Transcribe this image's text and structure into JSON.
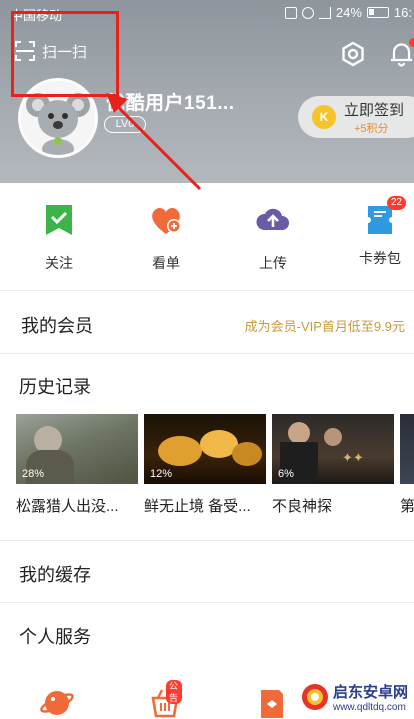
{
  "status_bar": {
    "carrier": "中国移动",
    "battery": "24%",
    "time": "16:"
  },
  "header": {
    "scan_label": "扫一扫",
    "username": "优酷用户151...",
    "level": "LV0",
    "checkin": {
      "label": "立即签到",
      "points": "+5积分",
      "coin": "K"
    }
  },
  "quick_actions": [
    {
      "label": "关注",
      "icon": "follow-check-icon",
      "color": "#3cb44a"
    },
    {
      "label": "看单",
      "icon": "heart-plus-icon",
      "color": "#f06a3a"
    },
    {
      "label": "上传",
      "icon": "cloud-upload-icon",
      "color": "#6b5aa8"
    },
    {
      "label": "卡券包",
      "icon": "ticket-icon",
      "color": "#2e9be0",
      "badge": "22"
    }
  ],
  "member": {
    "title": "我的会员",
    "promo": "成为会员-VIP首月低至9.9元"
  },
  "history": {
    "title": "历史记录",
    "items": [
      {
        "title": "松露猎人出没...",
        "progress": "28%"
      },
      {
        "title": "鲜无止境 备受...",
        "progress": "12%"
      },
      {
        "title": "不良神探",
        "progress": "6%"
      },
      {
        "title": "第",
        "progress": ""
      }
    ]
  },
  "cache": {
    "title": "我的缓存"
  },
  "services": {
    "title": "个人服务",
    "badge": "公告"
  },
  "watermark": {
    "title": "启东安卓网",
    "url": "www.qdltdq.com"
  },
  "colors": {
    "header_bg": "#9aa0a6",
    "highlight_red": "#e8211b",
    "promo_gold": "#c89b3c"
  }
}
